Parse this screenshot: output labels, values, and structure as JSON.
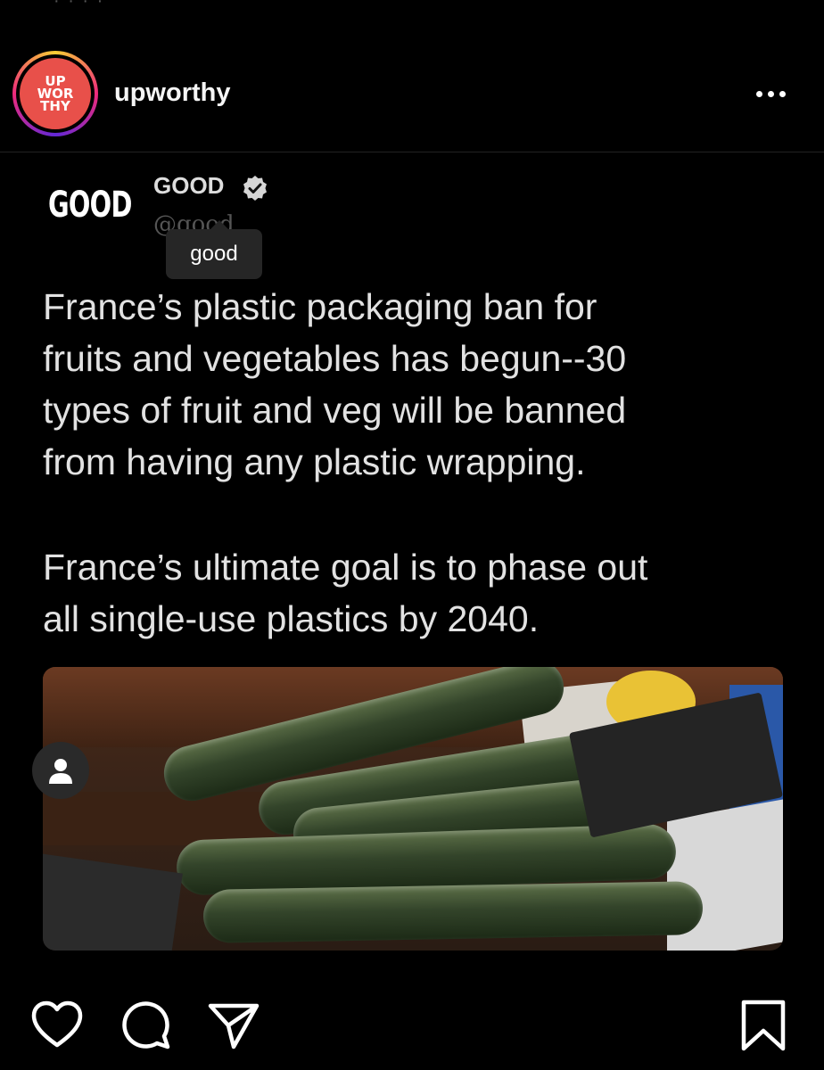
{
  "header": {
    "avatar_logo": [
      "UP",
      "WOR",
      "THY"
    ],
    "username": "upworthy",
    "more_icon": "more-horizontal-icon"
  },
  "tweet": {
    "logo_text": "GOOD",
    "name": "GOOD",
    "verified_icon": "verified-badge-icon",
    "handle": "@good",
    "tooltip": "good",
    "paragraph_1": "France’s plastic packaging ban for\nfruits and vegetables has begun--30\ntypes of fruit and veg will be banned\nfrom having any plastic wrapping.",
    "paragraph_2": "France’s ultimate goal is to phase out\nall single-use plastics by 2040."
  },
  "actions": {
    "icons": [
      "heart-icon",
      "comment-icon",
      "share-icon",
      "bookmark-icon"
    ]
  },
  "colors": {
    "background": "#000000",
    "avatar_brand": "#e8504a",
    "tooltip_bg": "#262626",
    "handle_gray": "#555555"
  }
}
